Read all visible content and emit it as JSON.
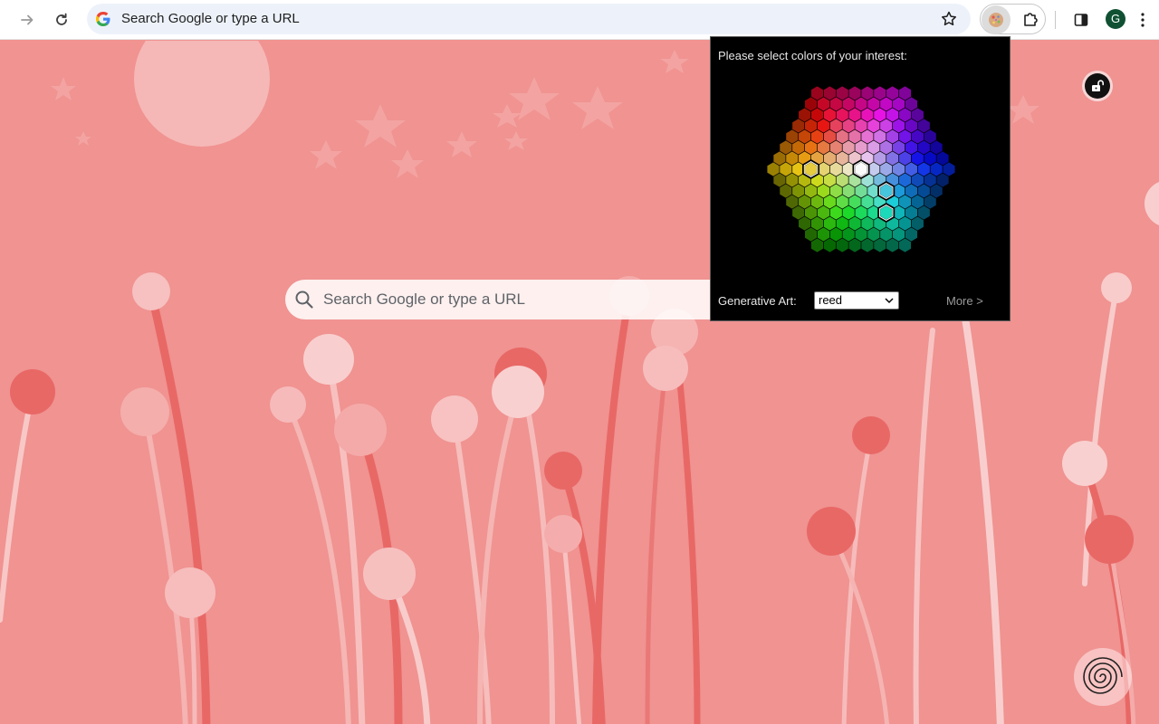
{
  "browser": {
    "omnibox_text": "Search Google or type a URL",
    "avatar_letter": "G",
    "icons": {
      "forward": "arrow-right-icon",
      "reload": "reload-icon",
      "google": "google-g-icon",
      "bookmark": "star-icon",
      "extension_active": "cookie-icon",
      "extensions": "puzzle-icon",
      "side_panel": "side-panel-icon",
      "menu": "kebab-menu-icon"
    }
  },
  "newtab": {
    "search_placeholder": "Search Google or type a URL",
    "background_color": "#f09391"
  },
  "popup": {
    "title": "Please select colors of your interest:",
    "generative_label": "Generative Art:",
    "generative_value": "reed",
    "more_label": "More >"
  }
}
